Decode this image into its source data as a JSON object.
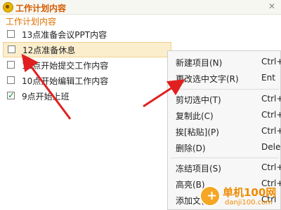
{
  "window": {
    "title": "工作计划内容",
    "close_glyph": "✕",
    "subheader": "工作计划内容"
  },
  "tasks": [
    {
      "label": "13点准备会议PPT内容",
      "checked": false,
      "selected": false
    },
    {
      "label": "12点准备休息",
      "checked": false,
      "selected": true
    },
    {
      "label": "11点开始提交工作内容",
      "checked": false,
      "selected": false
    },
    {
      "label": "10点开始编辑工作内容",
      "checked": false,
      "selected": false
    },
    {
      "label": "9点开始上班",
      "checked": true,
      "selected": false
    }
  ],
  "context_menu": {
    "items": [
      {
        "label": "新建项目(N)",
        "shortcut": "Ctrl+"
      },
      {
        "label": "更改选中文字(R)",
        "shortcut": "Ent"
      },
      {
        "label": "剪切选中(T)",
        "shortcut": "Ctrl+"
      },
      {
        "label": "复制此(C)",
        "shortcut": "Ctrl+"
      },
      {
        "label": "挨[粘贴](P)",
        "shortcut": "Ctrl+"
      },
      {
        "label": "删除(D)",
        "shortcut": "Dele"
      },
      {
        "label": "冻结项目(S)",
        "shortcut": "Ctrl+"
      },
      {
        "label": "高亮(B)",
        "shortcut": "Ctrl+"
      },
      {
        "label": "添加文(L)",
        "shortcut": "Ctrl"
      }
    ]
  },
  "watermark": {
    "line1": "单机100网",
    "line2": "danji100.com"
  },
  "colors": {
    "accent": "#d35a00",
    "selected_bg": "#fbeecd",
    "arrow": "#e0201f",
    "check": "#0a8a2a"
  }
}
